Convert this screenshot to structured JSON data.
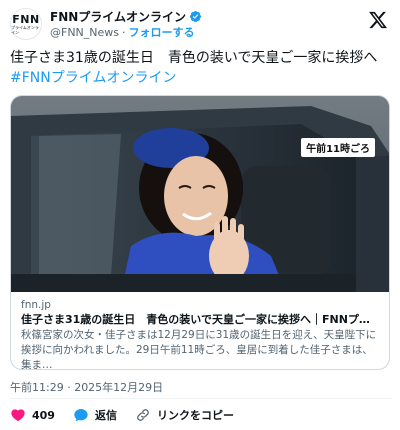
{
  "header": {
    "avatar_text_big": "FNN",
    "avatar_text_small": "プライムオンライン",
    "display_name": "FNNプライムオンライン",
    "handle": "@FNN_News",
    "separator": "·",
    "follow_label": "フォローする"
  },
  "tweet": {
    "text": "佳子さま31歳の誕生日　青色の装いで天皇ご一家に挨拶へ",
    "hashtag": "#FNNプライムオンライン"
  },
  "card": {
    "time_badge": "午前11時ごろ",
    "domain": "fnn.jp",
    "title": "佳子さま31歳の誕生日　青色の装いで天皇ご一家に挨拶へ｜FNNプライムオ…",
    "description": "秋篠宮家の次女・佳子さまは12月29日に31歳の誕生日を迎え、天皇陛下に挨拶に向かわれました。29日午前11時ごろ、皇居に到着した佳子さまは、集ま…"
  },
  "timestamp": "午前11:29 · 2025年12月29日",
  "actions": {
    "like_count": "409",
    "reply_label": "返信",
    "copy_link_label": "リンクをコピー"
  },
  "colors": {
    "accent": "#1d9bf0",
    "like": "#f91880",
    "text": "#0f1419",
    "secondary": "#536471"
  }
}
